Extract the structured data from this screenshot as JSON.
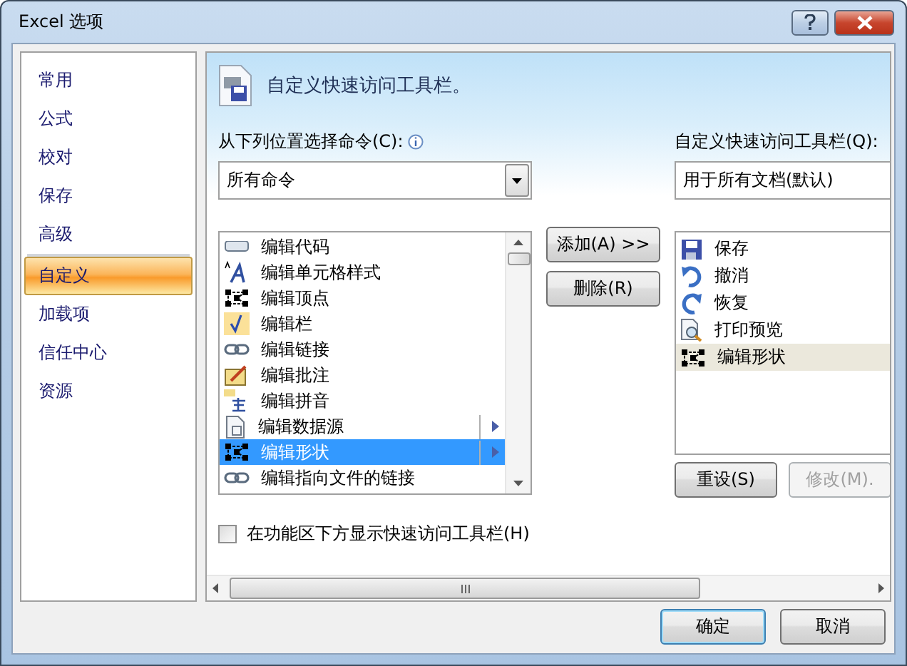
{
  "window": {
    "title": "Excel 选项"
  },
  "sidebar": {
    "items": [
      {
        "label": "常用",
        "selected": false,
        "separator_after": false
      },
      {
        "label": "公式",
        "selected": false,
        "separator_after": false
      },
      {
        "label": "校对",
        "selected": false,
        "separator_after": false
      },
      {
        "label": "保存",
        "selected": false,
        "separator_after": false
      },
      {
        "label": "高级",
        "selected": false,
        "separator_after": true
      },
      {
        "label": "自定义",
        "selected": true,
        "separator_after": false
      },
      {
        "label": "加载项",
        "selected": false,
        "separator_after": false
      },
      {
        "label": "信任中心",
        "selected": false,
        "separator_after": false
      },
      {
        "label": "资源",
        "selected": false,
        "separator_after": false
      }
    ]
  },
  "header": {
    "title": "自定义快速访问工具栏。"
  },
  "commands": {
    "label": "从下列位置选择命令(C):",
    "dropdown": {
      "value": "所有命令"
    },
    "items": [
      {
        "label": "编辑代码",
        "selected": false,
        "has_submenu": false
      },
      {
        "label": "编辑单元格样式",
        "selected": false,
        "has_submenu": false
      },
      {
        "label": "编辑顶点",
        "selected": false,
        "has_submenu": false
      },
      {
        "label": "编辑栏",
        "selected": false,
        "has_submenu": false
      },
      {
        "label": "编辑链接",
        "selected": false,
        "has_submenu": false
      },
      {
        "label": "编辑批注",
        "selected": false,
        "has_submenu": false
      },
      {
        "label": "编辑拼音",
        "selected": false,
        "has_submenu": false
      },
      {
        "label": "编辑数据源",
        "selected": false,
        "has_submenu": true
      },
      {
        "label": "编辑形状",
        "selected": true,
        "has_submenu": true
      },
      {
        "label": "编辑指向文件的链接",
        "selected": false,
        "has_submenu": false
      }
    ]
  },
  "transfer_buttons": [
    {
      "label": "添加(A) >>",
      "disabled": false
    },
    {
      "label": "删除(R)",
      "disabled": false
    }
  ],
  "toolbar": {
    "label": "自定义快速访问工具栏(Q):",
    "dropdown": {
      "value": "用于所有文档(默认)"
    },
    "items": [
      {
        "label": "保存",
        "selected": false
      },
      {
        "label": "撤消",
        "selected": false
      },
      {
        "label": "恢复",
        "selected": false
      },
      {
        "label": "打印预览",
        "selected": false
      },
      {
        "label": "编辑形状",
        "selected": true
      }
    ],
    "buttons": [
      {
        "label": "重设(S)",
        "disabled": false
      },
      {
        "label": "修改(M).",
        "disabled": true
      }
    ]
  },
  "show_below_ribbon": {
    "label": "在功能区下方显示快速访问工具栏(H)",
    "checked": false
  },
  "dialog_buttons": [
    {
      "label": "确定",
      "default": true
    },
    {
      "label": "取消",
      "default": false
    }
  ]
}
